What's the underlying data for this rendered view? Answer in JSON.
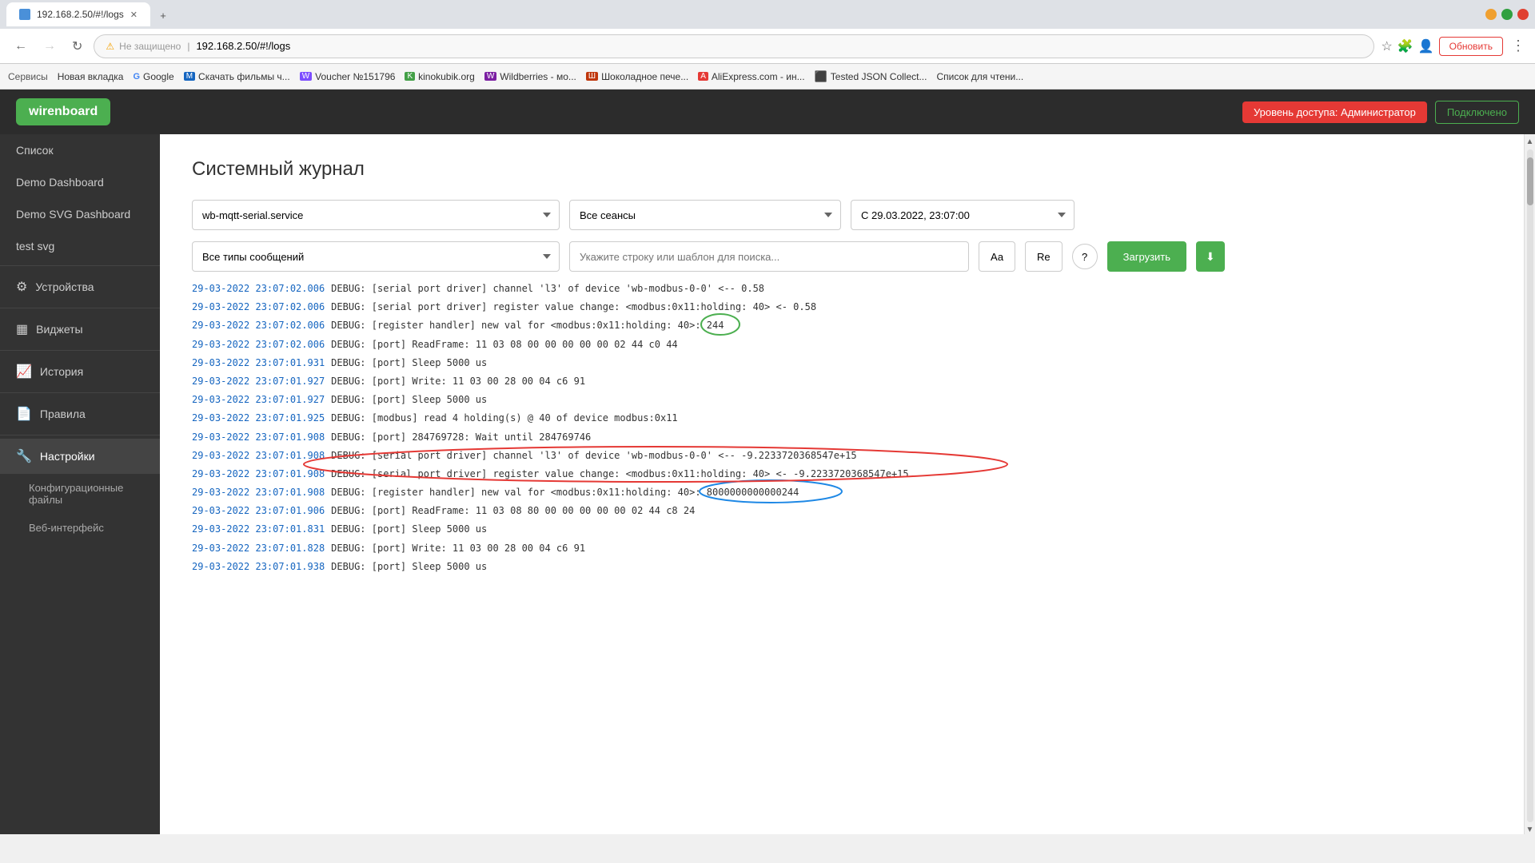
{
  "browser": {
    "tabs": [
      {
        "label": "192.168.2.50/#!/logs",
        "active": true
      }
    ],
    "address": "192.168.2.50/#!/logs",
    "address_prefix": "Не защищено",
    "update_btn": "Обновить",
    "bookmarks": [
      {
        "label": "Сервисы"
      },
      {
        "label": "Новая вкладка"
      },
      {
        "label": "Google"
      },
      {
        "label": "Скачать фильмы ч..."
      },
      {
        "label": "Voucher №151796"
      },
      {
        "label": "kinokubik.org"
      },
      {
        "label": "Wildberries - мо..."
      },
      {
        "label": "Шоколадное пече..."
      },
      {
        "label": "AliExpress.com - ин..."
      },
      {
        "label": "Tested JSON Collect..."
      },
      {
        "label": "Список для чтени..."
      }
    ]
  },
  "app": {
    "logo": "wirenboard",
    "access_label": "Уровень доступа: Администратор",
    "connect_label": "Подключено"
  },
  "sidebar": {
    "items": [
      {
        "label": "Список",
        "icon": "",
        "type": "item"
      },
      {
        "label": "Demo Dashboard",
        "icon": "",
        "type": "item"
      },
      {
        "label": "Demo SVG Dashboard",
        "icon": "",
        "type": "item"
      },
      {
        "label": "test svg",
        "icon": "",
        "type": "item"
      },
      {
        "label": "Устройства",
        "icon": "⚙",
        "type": "section"
      },
      {
        "label": "Виджеты",
        "icon": "▤",
        "type": "section"
      },
      {
        "label": "История",
        "icon": "📄",
        "type": "section"
      },
      {
        "label": "Правила",
        "icon": "📋",
        "type": "section"
      },
      {
        "label": "Настройки",
        "icon": "🔧",
        "type": "section",
        "active": true
      },
      {
        "label": "Конфигурационные файлы",
        "icon": "",
        "type": "sub"
      },
      {
        "label": "Веб-интерфейс",
        "icon": "",
        "type": "sub"
      }
    ]
  },
  "page": {
    "title": "Системный журнал",
    "filter_service": "wb-mqtt-serial.service",
    "filter_sessions": "Все сеансы",
    "filter_date": "С 29.03.2022, 23:07:00",
    "filter_message_types": "Все типы сообщений",
    "search_placeholder": "Укажите строку или шаблон для поиска...",
    "btn_aa": "Аа",
    "btn_re": "Re",
    "btn_help": "?",
    "btn_load": "Загрузить",
    "btn_download": "⬇"
  },
  "logs": [
    {
      "time": "29-03-2022 23:07:02.006",
      "text": "DEBUG: [serial port driver] channel 'l3' of device 'wb-modbus-0-0' <-- 0.58",
      "highlight": "none"
    },
    {
      "time": "29-03-2022 23:07:02.006",
      "text": "DEBUG: [serial port driver] register value change: <modbus:0x11:holding: 40> <- 0.58",
      "highlight": "none"
    },
    {
      "time": "29-03-2022 23:07:02.006",
      "text": "DEBUG: [register handler] new val for <modbus:0x11:holding: 40>: 244",
      "highlight": "green",
      "highlight_text": "244"
    },
    {
      "time": "29-03-2022 23:07:02.006",
      "text": "DEBUG: [port] ReadFrame: 11 03 08 00 00 00 00 00 02 44 c0 44",
      "highlight": "none"
    },
    {
      "time": "29-03-2022 23:07:01.931",
      "text": "DEBUG: [port] Sleep 5000 us",
      "highlight": "none"
    },
    {
      "time": "29-03-2022 23:07:01.927",
      "text": "DEBUG: [port] Write: 11 03 00 28 00 04 c6 91",
      "highlight": "none"
    },
    {
      "time": "29-03-2022 23:07:01.927",
      "text": "DEBUG: [port] Sleep 5000 us",
      "highlight": "none"
    },
    {
      "time": "29-03-2022 23:07:01.925",
      "text": "DEBUG: [modbus] read 4 holding(s) @ 40 of device modbus:0x11",
      "highlight": "none"
    },
    {
      "time": "29-03-2022 23:07:01.908",
      "text": "DEBUG: [port] 284769728: Wait until 284769746",
      "highlight": "none"
    },
    {
      "time": "29-03-2022 23:07:01.908",
      "text": "DEBUG: [serial port driver] channel 'l3' of device 'wb-modbus-0-0' <-- -9.2233720368547e+15",
      "highlight": "red"
    },
    {
      "time": "29-03-2022 23:07:01.908",
      "text": "DEBUG: [serial port driver] register value change: <modbus:0x11:holding: 40> <- -9.2233720368547e+15",
      "highlight": "red"
    },
    {
      "time": "29-03-2022 23:07:01.908",
      "text": "DEBUG: [register handler] new val for <modbus:0x11:holding: 40>: 8000000000000244",
      "highlight": "blue",
      "highlight_text": "8000000000000244"
    },
    {
      "time": "29-03-2022 23:07:01.906",
      "text": "DEBUG: [port] ReadFrame: 11 03 08 80 00 00 00 00 00 02 44 c8 24",
      "highlight": "none"
    },
    {
      "time": "29-03-2022 23:07:01.831",
      "text": "DEBUG: [port] Sleep 5000 us",
      "highlight": "none"
    },
    {
      "time": "29-03-2022 23:07:01.828",
      "text": "DEBUG: [port] Write: 11 03 00 28 00 04 c6 91",
      "highlight": "none"
    },
    {
      "time": "29-03-2022 23:07:01.938",
      "text": "DEBUG: [port] Sleep 5000 us",
      "highlight": "none"
    }
  ]
}
